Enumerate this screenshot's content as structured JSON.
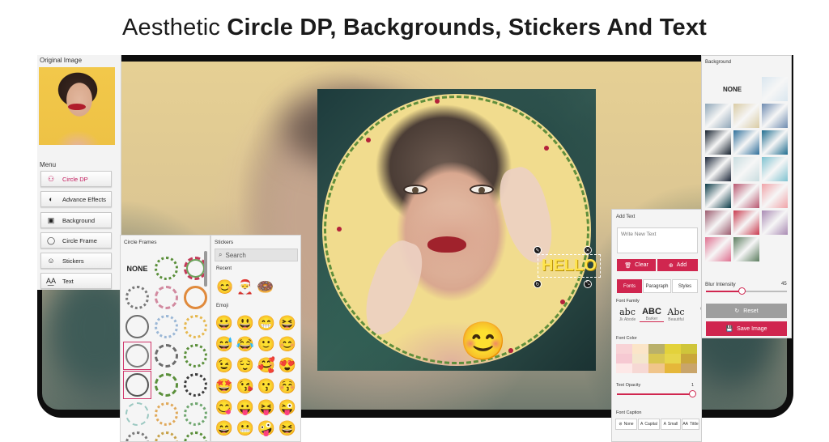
{
  "banner": {
    "regular": "Aesthetic ",
    "bold": "Circle DP, Backgrounds, Stickers And Text"
  },
  "left_panel": {
    "original_label": "Original Image",
    "menu_label": "Menu",
    "items": [
      {
        "label": "Circle DP",
        "icon": "person-circle-icon",
        "glyph": "⚇",
        "active": true
      },
      {
        "label": "Advance Effects",
        "icon": "effects-icon",
        "glyph": "◐"
      },
      {
        "label": "Background",
        "icon": "background-icon",
        "glyph": "▣"
      },
      {
        "label": "Circle Frame",
        "icon": "circle-frame-icon",
        "glyph": "◯"
      },
      {
        "label": "Stickers",
        "icon": "sticker-icon",
        "glyph": "☺"
      },
      {
        "label": "Text",
        "icon": "text-icon",
        "glyph": "A͟A"
      }
    ]
  },
  "canvas": {
    "text_sticker": "HELLO",
    "emoji_sticker": "😊"
  },
  "frames_panel": {
    "title": "Circle Frames",
    "none_label": "NONE"
  },
  "stickers_panel": {
    "title": "Stickers",
    "search_placeholder": "Search",
    "recent_label": "Recent",
    "recent": [
      "😊",
      "🎅",
      "🍩"
    ],
    "emoji_label": "Emoji",
    "emoji": [
      "😀",
      "😃",
      "😁",
      "😆",
      "😅",
      "😂",
      "🙂",
      "😊",
      "😉",
      "😌",
      "🥰",
      "😍",
      "🤩",
      "😘",
      "😗",
      "😚",
      "😋",
      "😛",
      "😝",
      "😜",
      "😄",
      "😬",
      "🤪",
      "😆"
    ]
  },
  "text_panel": {
    "title": "Add Text",
    "input_placeholder": "Write New Text",
    "clear_label": "Clear",
    "add_label": "Add",
    "tabs": [
      "Fonts",
      "Paragraph",
      "Styles"
    ],
    "font_family_label": "Font Family",
    "fonts": [
      {
        "sample": "abc",
        "name": "Jk Abode"
      },
      {
        "sample": "ABC",
        "name": "Barker"
      },
      {
        "sample": "Abc",
        "name": "Beautiful"
      },
      {
        "sample": "",
        "name": "G"
      }
    ],
    "font_color_label": "Font Color",
    "swatches": [
      "#f8d3d6",
      "#fbe5c8",
      "#b9b06a",
      "#e3d23b",
      "#cfc53a",
      "#f6c9d2",
      "#f4e6cd",
      "#d8c651",
      "#e7d64b",
      "#c9a73b",
      "#fde8e7",
      "#f6d8d4",
      "#f0c58b",
      "#e5b73a",
      "#c9a56a"
    ],
    "opacity_label": "Text Opacity",
    "opacity_value": "1",
    "opacity": 1,
    "caption_label": "Font Caption",
    "captions": [
      "None",
      "Capital",
      "Small",
      "Tittle"
    ]
  },
  "bg_panel": {
    "title": "Background",
    "none_label": "NONE",
    "thumbs": [
      "#d9e6ef",
      "#8fa6b8",
      "#d9cba4",
      "#6e8bb0",
      "#16212e",
      "#2f6f9a",
      "#1f6d8f",
      "#1b2638",
      "#c9dde0",
      "#7fc2d0",
      "#0c3c48",
      "#b8566f",
      "#f0a3a8",
      "#9b5b6e",
      "#c93b4f",
      "#a98ab3",
      "#df6f8f",
      "#5b7c5e"
    ],
    "blur_label": "Blur Intensity",
    "blur_value": "45",
    "blur": 0.45,
    "reset_label": "Reset",
    "save_label": "Save Image"
  }
}
